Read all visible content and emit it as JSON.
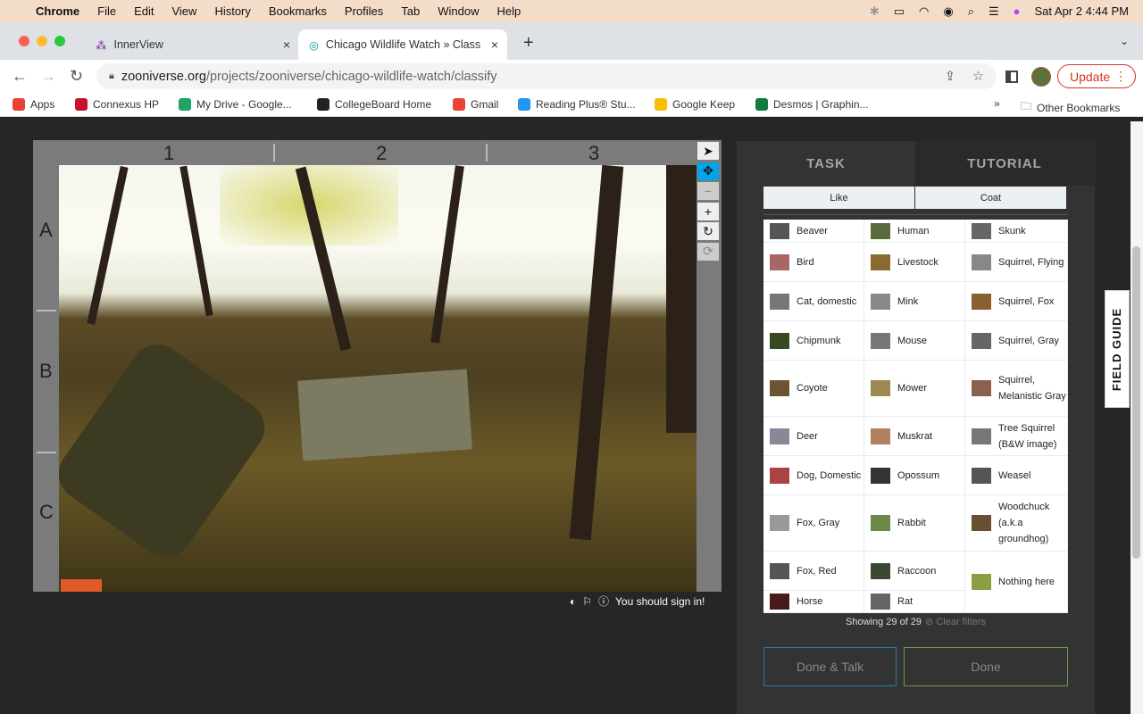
{
  "menubar": {
    "app": "Chrome",
    "items": [
      "File",
      "Edit",
      "View",
      "History",
      "Bookmarks",
      "Profiles",
      "Tab",
      "Window",
      "Help"
    ],
    "clock": "Sat Apr 2  4:44 PM"
  },
  "tabs": [
    {
      "title": "InnerView"
    },
    {
      "title": "Chicago Wildlife Watch » Class"
    }
  ],
  "url": {
    "host": "zooniverse.org",
    "path": "/projects/zooniverse/chicago-wildlife-watch/classify"
  },
  "update_label": "Update",
  "bookmarks": [
    {
      "label": "Apps",
      "color": "#e94235"
    },
    {
      "label": "Connexus HP",
      "color": "#c8102e"
    },
    {
      "label": "My Drive - Google...",
      "color": "#1fa463"
    },
    {
      "label": "CollegeBoard Home",
      "color": "#222"
    },
    {
      "label": "Gmail",
      "color": "#ea4335"
    },
    {
      "label": "Reading Plus® Stu...",
      "color": "#2196f3"
    },
    {
      "label": "Google Keep",
      "color": "#fbbc04"
    },
    {
      "label": "Desmos | Graphin...",
      "color": "#127a3b"
    }
  ],
  "other_bookmarks": "Other Bookmarks",
  "viewer": {
    "columns": [
      "1",
      "2",
      "3"
    ],
    "rows": [
      "A",
      "B",
      "C"
    ],
    "sign_in": "You should sign in!"
  },
  "panel": {
    "tabs": [
      "TASK",
      "TUTORIAL"
    ],
    "filters": [
      "Like",
      "Coat"
    ],
    "species": [
      {
        "name": "Beaver",
        "color": "#555"
      },
      {
        "name": "Bird",
        "color": "#a66"
      },
      {
        "name": "Cat, domestic",
        "color": "#777"
      },
      {
        "name": "Chipmunk",
        "color": "#3a4a20"
      },
      {
        "name": "Coyote",
        "color": "#6b5530"
      },
      {
        "name": "Deer",
        "color": "#889"
      },
      {
        "name": "Dog, Domestic",
        "color": "#a44"
      },
      {
        "name": "Fox, Gray",
        "color": "#999"
      },
      {
        "name": "Fox, Red",
        "color": "#555"
      },
      {
        "name": "Horse",
        "color": "#4a1a1a"
      },
      {
        "name": "Human",
        "color": "#5a6a3a"
      },
      {
        "name": "Livestock",
        "color": "#8a6a30"
      },
      {
        "name": "Mink",
        "color": "#888"
      },
      {
        "name": "Mouse",
        "color": "#777"
      },
      {
        "name": "Mower",
        "color": "#9a8a50"
      },
      {
        "name": "Muskrat",
        "color": "#b08060"
      },
      {
        "name": "Opossum",
        "color": "#333"
      },
      {
        "name": "Rabbit",
        "color": "#6a8a4a"
      },
      {
        "name": "Raccoon",
        "color": "#3a4a30"
      },
      {
        "name": "Rat",
        "color": "#666"
      },
      {
        "name": "Skunk",
        "color": "#666"
      },
      {
        "name": "Squirrel, Flying",
        "color": "#888"
      },
      {
        "name": "Squirrel, Fox",
        "color": "#8a6030"
      },
      {
        "name": "Squirrel, Gray",
        "color": "#666"
      },
      {
        "name": "Squirrel, Melanistic Gray",
        "color": "#8a6050"
      },
      {
        "name": "Tree Squirrel (B&W image)",
        "color": "#777"
      },
      {
        "name": "Weasel",
        "color": "#555"
      },
      {
        "name": "Woodchuck (a.k.a groundhog)",
        "color": "#6a5030"
      },
      {
        "name": "Nothing here",
        "color": "#8aa040"
      }
    ],
    "showing": "Showing 29 of 29",
    "clear_filters": "Clear filters",
    "done_talk": "Done & Talk",
    "done": "Done"
  },
  "field_guide": "FIELD GUIDE"
}
